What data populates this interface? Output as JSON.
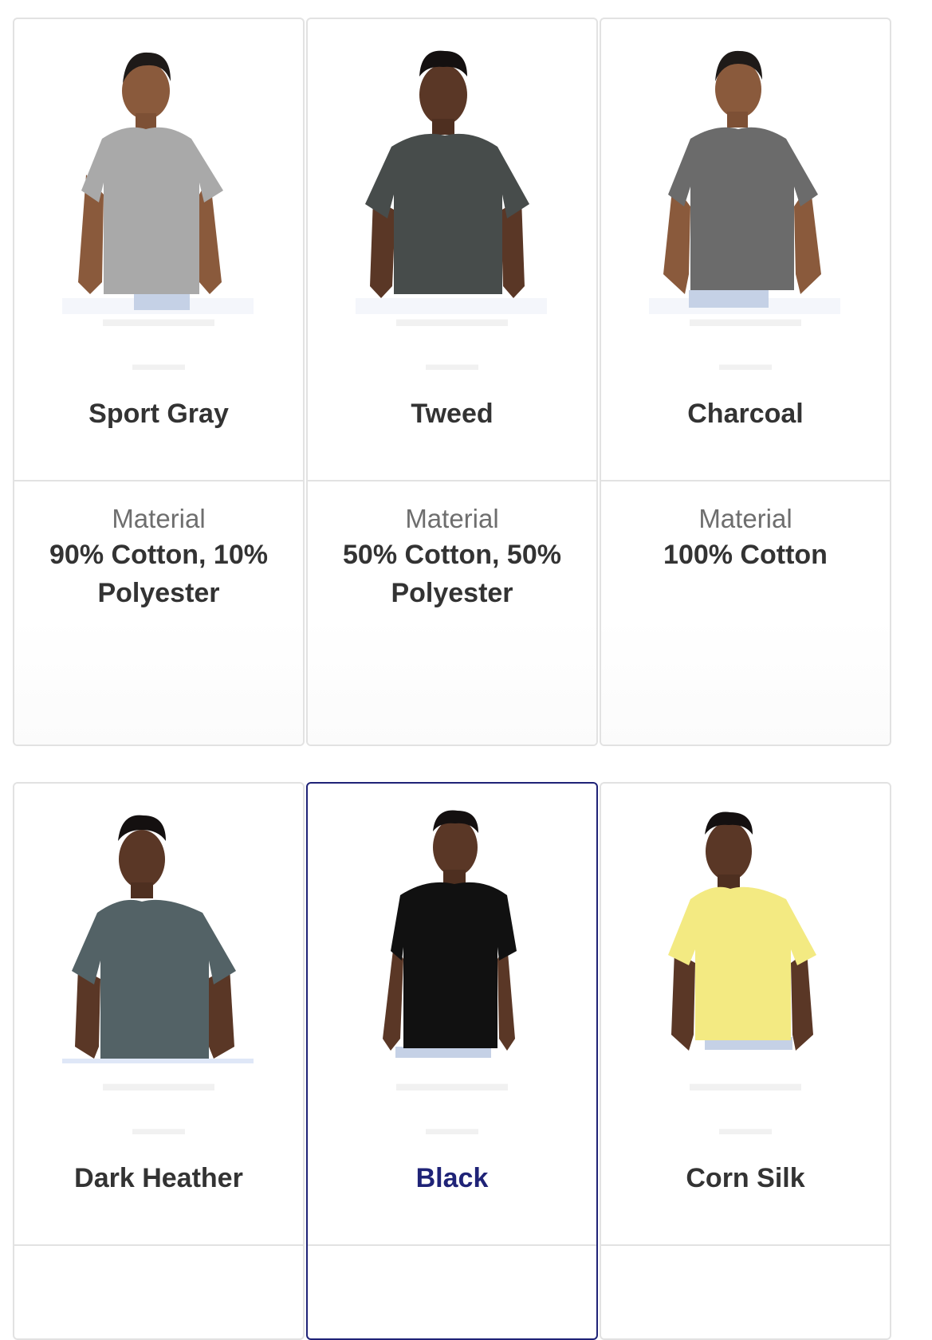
{
  "products": [
    {
      "color": "Sport Gray",
      "material_label": "Material",
      "material": "90% Cotton, 10% Polyester",
      "shirt_color": "#a9a9a9",
      "skin": "#8a5a3c",
      "selected": false
    },
    {
      "color": "Tweed",
      "material_label": "Material",
      "material": "50% Cotton, 50% Polyester",
      "shirt_color": "#474c4b",
      "skin": "#5a3726",
      "selected": false
    },
    {
      "color": "Charcoal",
      "material_label": "Material",
      "material": "100% Cotton",
      "shirt_color": "#6b6b6b",
      "skin": "#8a5a3c",
      "selected": false
    },
    {
      "color": "Dark Heather",
      "shirt_color": "#536266",
      "skin": "#5a3726",
      "selected": false
    },
    {
      "color": "Black",
      "shirt_color": "#111111",
      "skin": "#5a3726",
      "selected": true
    },
    {
      "color": "Corn Silk",
      "shirt_color": "#f3ea82",
      "skin": "#5a3726",
      "selected": false
    }
  ],
  "accent_color": "#1f2377"
}
